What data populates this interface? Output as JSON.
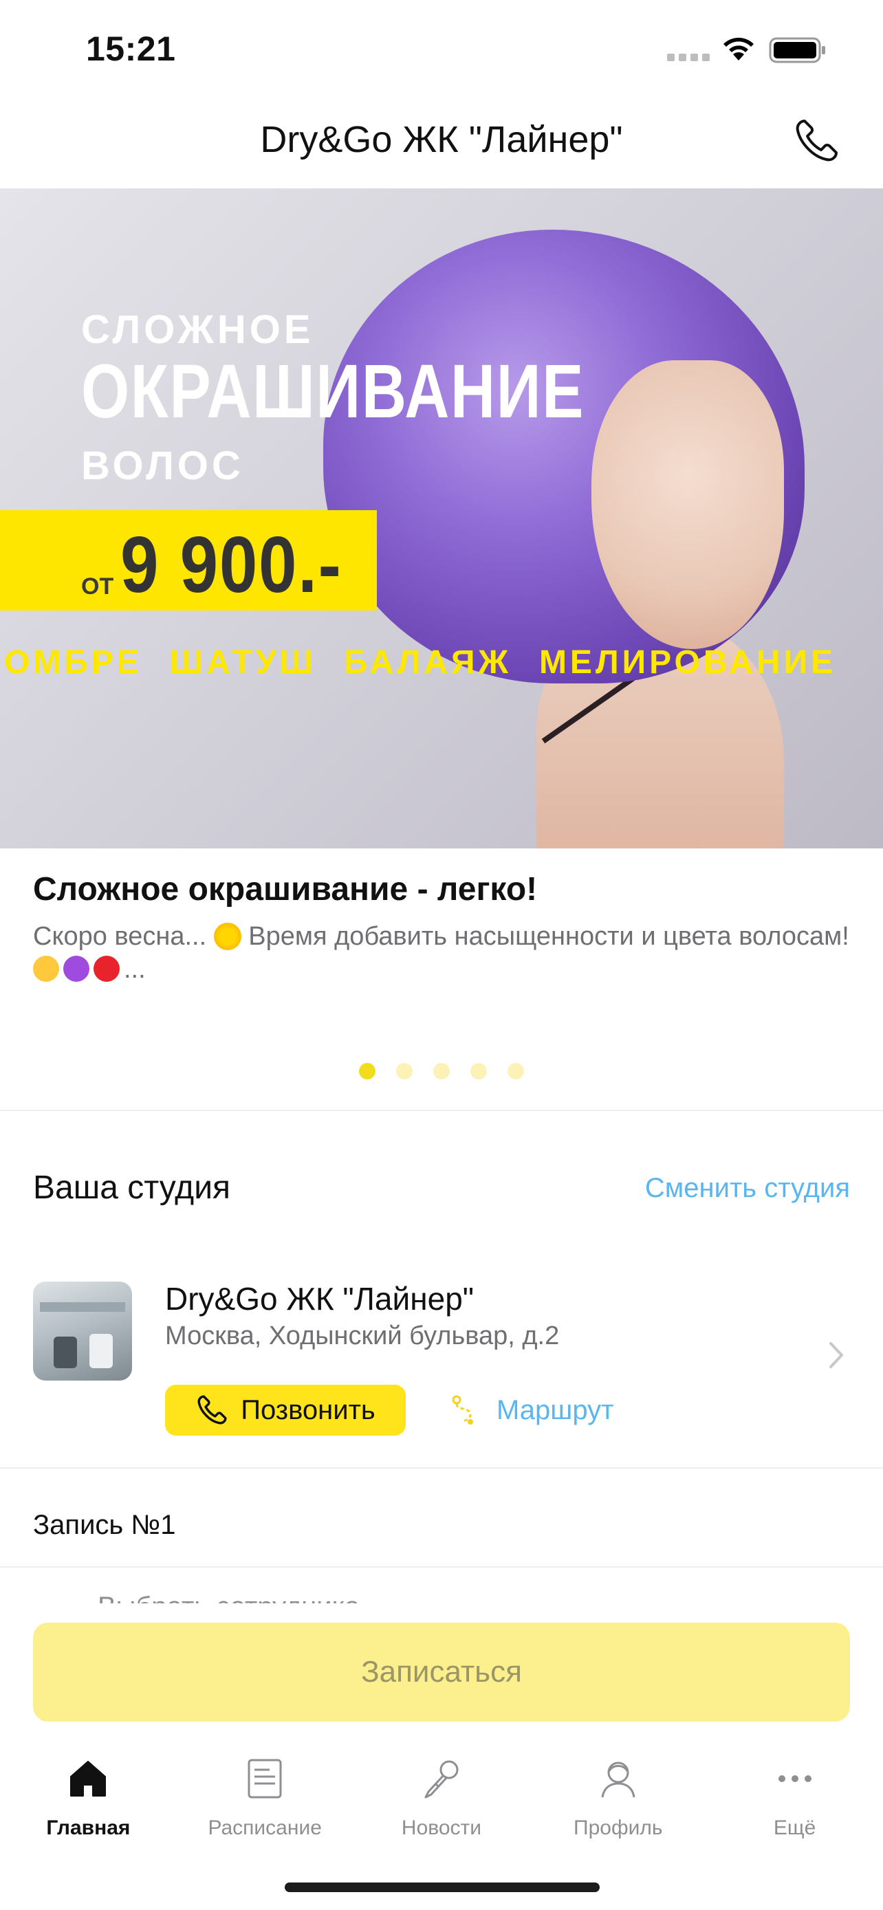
{
  "status_bar": {
    "time": "15:21"
  },
  "header": {
    "title": "Dry&Go ЖК \"Лайнер\"",
    "phone_icon": "phone-icon"
  },
  "banner": {
    "line1": "СЛОЖНОЕ",
    "line2": "ОКРАШИВАНИЕ",
    "line3": "ВОЛОС",
    "price_prefix": "ОТ",
    "price": "9 900.-",
    "services": [
      "ОМБРЕ",
      "ШАТУШ",
      "БАЛАЯЖ",
      "МЕЛИРОВАНИЕ"
    ],
    "accent_color": "#ffe600"
  },
  "news": {
    "title": "Сложное окрашивание - легко!",
    "desc_part1": "Скоро весна... ",
    "desc_part2": " Время добавить насыщенности и цвета волосам! ",
    "desc_end": "...",
    "page_count": 5,
    "active_page": 1
  },
  "studio": {
    "heading": "Ваша студия",
    "change_label": "Сменить студия",
    "name": "Dry&Go ЖК \"Лайнер\"",
    "address": "Москва, Ходынский бульвар, д.2",
    "call_label": "Позвонить",
    "route_label": "Маршрут"
  },
  "booking": {
    "label": "Запись №1",
    "employee_placeholder": "Выбрать сотрудника",
    "submit_label": "Записаться"
  },
  "tabs": [
    {
      "label": "Главная",
      "icon": "home-icon",
      "active": true
    },
    {
      "label": "Расписание",
      "icon": "schedule-icon",
      "active": false
    },
    {
      "label": "Новости",
      "icon": "news-icon",
      "active": false
    },
    {
      "label": "Профиль",
      "icon": "profile-icon",
      "active": false
    },
    {
      "label": "Ещё",
      "icon": "more-icon",
      "active": false
    }
  ],
  "colors": {
    "brand_yellow": "#ffe41c",
    "link_blue": "#5ab6f0"
  }
}
